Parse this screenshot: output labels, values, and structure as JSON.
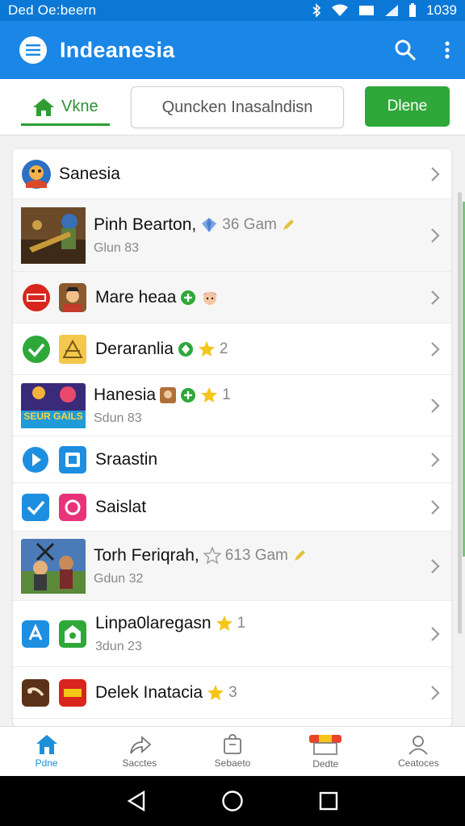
{
  "status_bar": {
    "left_text": "Ded Oe:beern",
    "time": "1039"
  },
  "app_bar": {
    "title": "Indeanesia"
  },
  "tabs": {
    "home_label": "Vkne",
    "search_value": "Quncken Inasalndisn",
    "done_label": "Dlene"
  },
  "list": {
    "rows": [
      {
        "name": "Sanesia"
      },
      {
        "name": "Pinh Bearton,",
        "meta": "36 Gam",
        "sub": "Glun 83"
      },
      {
        "name": "Mare heaa"
      },
      {
        "name": "Deraranlia",
        "meta": "2"
      },
      {
        "name": "Hanesia",
        "meta": "1",
        "sub": "Sdun 83",
        "thumb_text": "SEUR GAILS"
      },
      {
        "name": "Sraastin"
      },
      {
        "name": "Saislat"
      },
      {
        "name": "Torh Feriqrah,",
        "meta": "613 Gam",
        "sub": "Gdun 32"
      },
      {
        "name": "Linpa0laregasn",
        "meta": "1",
        "sub": "3dun 23"
      },
      {
        "name": "Delek Inatacia",
        "meta": "3"
      }
    ]
  },
  "bottom_nav": {
    "items": [
      "Pdne",
      "Sacctes",
      "Sebaeto",
      "Dedte",
      "Ceatoces"
    ]
  },
  "colors": {
    "primary": "#1a86e6",
    "status_bar": "#0b78d6",
    "accent_green": "#2fa83a",
    "active_nav": "#1c8fd8"
  }
}
